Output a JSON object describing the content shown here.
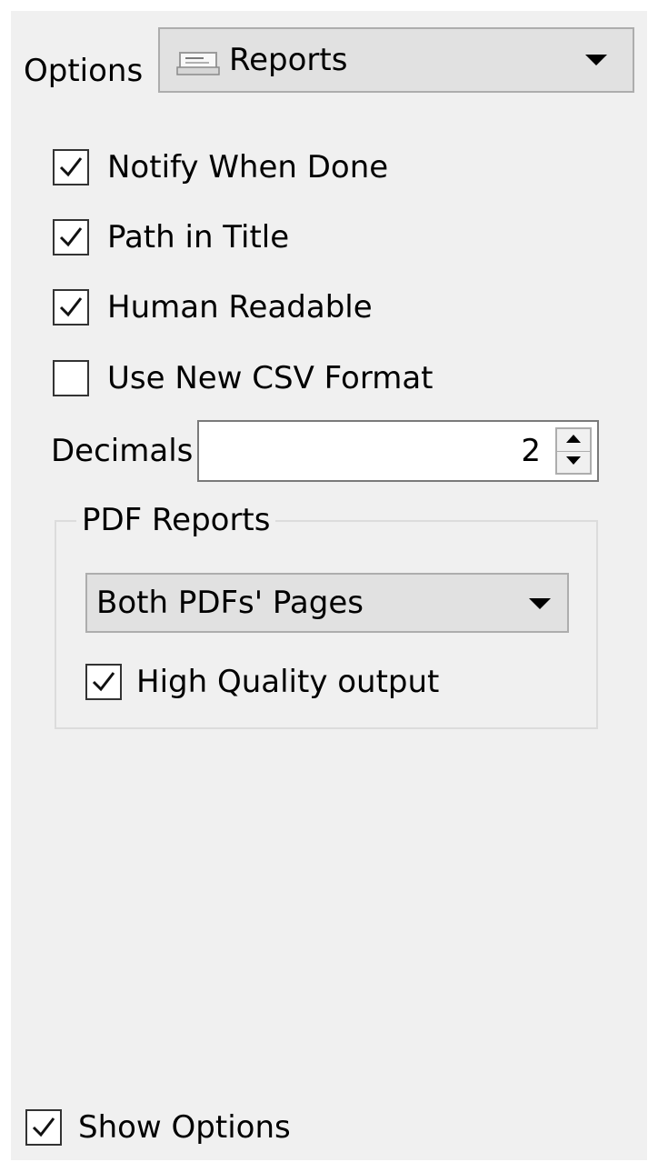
{
  "options": {
    "label": "Options",
    "selected": "Reports",
    "icon": "report-icon"
  },
  "checkboxes": [
    {
      "label": "Notify When Done",
      "checked": true
    },
    {
      "label": "Path in Title",
      "checked": true
    },
    {
      "label": "Human Readable",
      "checked": true
    },
    {
      "label": "Use New CSV Format",
      "checked": false
    }
  ],
  "decimals": {
    "label": "Decimals",
    "value": "2"
  },
  "pdf_reports": {
    "title": "PDF Reports",
    "selected": "Both PDFs' Pages",
    "high_quality": {
      "label": "High Quality output",
      "checked": true
    }
  },
  "show_options": {
    "label": "Show Options",
    "checked": true
  }
}
